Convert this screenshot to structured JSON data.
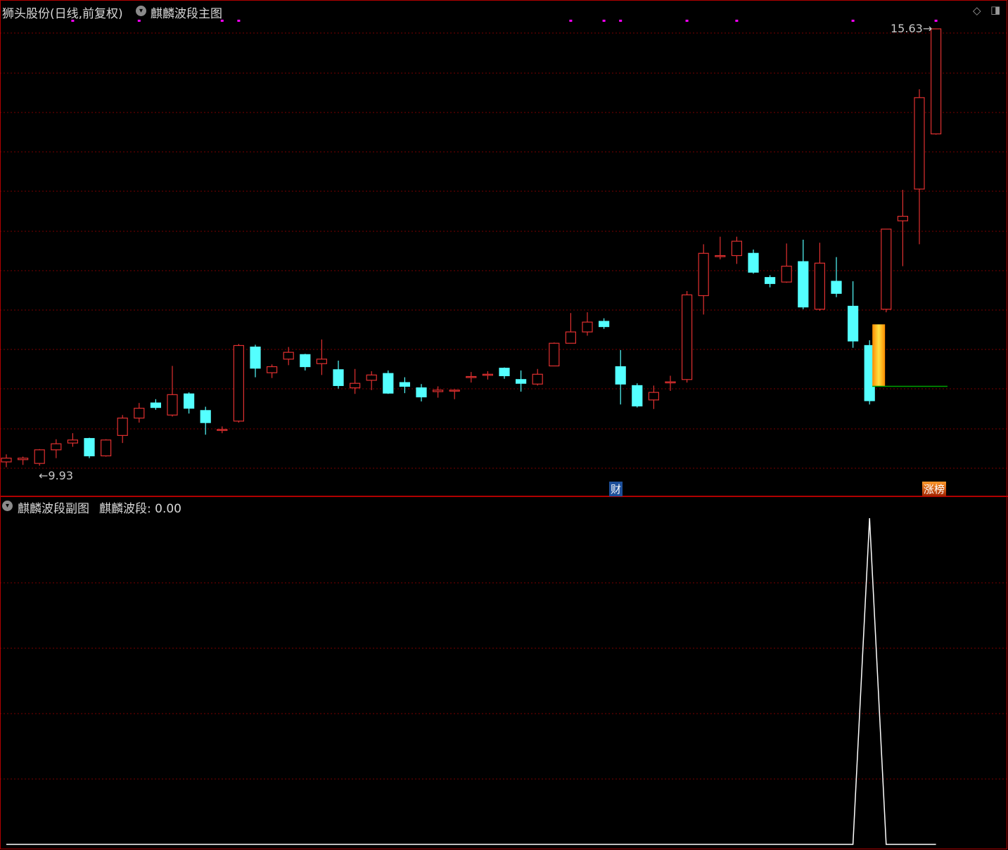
{
  "main_panel": {
    "stock_title": "狮头股份(日线,前复权)",
    "indicator_name": "麒麟波段主图",
    "high_label": "15.63",
    "low_label": "9.93",
    "tag_finance": "财",
    "tag_limit_up": "涨榜"
  },
  "sub_panel": {
    "indicator_name": "麒麟波段副图",
    "series_label": "麒麟波段:",
    "series_value": "0.00"
  },
  "icons": [
    "chevron-down-icon",
    "diamond-icon",
    "window-icon"
  ],
  "colors": {
    "up": "#e03030",
    "down": "#54ffff",
    "grid": "#7a0000",
    "separator": "#b00000",
    "marker": "#ff00ff",
    "support_line": "#00a000",
    "signal_bar": "#ffaa00",
    "sub_line": "#ffffff"
  },
  "chart_data": [
    {
      "type": "candlestick",
      "title": "麒麟波段主图",
      "ylim": [
        9.5,
        16.0
      ],
      "grid": true,
      "annotations": [
        {
          "text": "15.63",
          "kind": "period-high"
        },
        {
          "text": "9.93",
          "kind": "period-low"
        }
      ],
      "candles": [
        [
          10.0,
          10.05,
          9.93,
          10.1
        ],
        [
          10.03,
          10.05,
          9.96,
          10.07
        ],
        [
          9.98,
          10.16,
          9.95,
          10.17
        ],
        [
          10.16,
          10.24,
          10.05,
          10.3
        ],
        [
          10.25,
          10.29,
          10.2,
          10.38
        ],
        [
          10.31,
          10.08,
          10.05,
          10.32
        ],
        [
          10.08,
          10.29,
          10.07,
          10.3
        ],
        [
          10.35,
          10.58,
          10.25,
          10.62
        ],
        [
          10.58,
          10.71,
          10.52,
          10.78
        ],
        [
          10.78,
          10.72,
          10.69,
          10.83
        ],
        [
          10.62,
          10.89,
          10.6,
          11.27
        ],
        [
          10.9,
          10.71,
          10.64,
          10.92
        ],
        [
          10.68,
          10.52,
          10.36,
          10.73
        ],
        [
          10.42,
          10.43,
          10.38,
          10.47
        ],
        [
          10.54,
          11.54,
          10.52,
          11.56
        ],
        [
          11.52,
          11.24,
          11.12,
          11.55
        ],
        [
          11.18,
          11.26,
          11.11,
          11.29
        ],
        [
          11.36,
          11.45,
          11.28,
          11.52
        ],
        [
          11.42,
          11.26,
          11.21,
          11.43
        ],
        [
          11.3,
          11.36,
          11.15,
          11.62
        ],
        [
          11.22,
          11.01,
          10.97,
          11.34
        ],
        [
          10.98,
          11.04,
          10.9,
          11.23
        ],
        [
          11.08,
          11.15,
          10.95,
          11.2
        ],
        [
          11.17,
          10.91,
          10.9,
          11.21
        ],
        [
          11.05,
          11.0,
          10.91,
          11.12
        ],
        [
          10.98,
          10.86,
          10.8,
          11.03
        ],
        [
          10.93,
          10.95,
          10.85,
          11.0
        ],
        [
          10.94,
          10.95,
          10.83,
          10.96
        ],
        [
          11.12,
          11.13,
          11.05,
          11.19
        ],
        [
          11.15,
          11.16,
          11.09,
          11.2
        ],
        [
          11.24,
          11.14,
          11.1,
          11.25
        ],
        [
          11.09,
          11.04,
          10.93,
          11.21
        ],
        [
          11.03,
          11.16,
          11.01,
          11.23
        ],
        [
          11.27,
          11.57,
          11.27,
          11.58
        ],
        [
          11.57,
          11.72,
          11.6,
          11.97
        ],
        [
          11.72,
          11.85,
          11.67,
          11.98
        ],
        [
          11.86,
          11.79,
          11.76,
          11.9
        ],
        [
          11.26,
          11.03,
          10.76,
          11.48
        ],
        [
          11.01,
          10.74,
          10.72,
          11.04
        ],
        [
          10.82,
          10.92,
          10.7,
          11.01
        ],
        [
          11.05,
          11.06,
          10.94,
          11.14
        ],
        [
          11.09,
          12.21,
          11.05,
          12.26
        ],
        [
          12.2,
          12.76,
          11.95,
          12.88
        ],
        [
          12.72,
          12.73,
          12.68,
          12.98
        ],
        [
          12.73,
          12.92,
          12.62,
          12.98
        ],
        [
          12.76,
          12.51,
          12.49,
          12.81
        ],
        [
          12.44,
          12.36,
          12.31,
          12.47
        ],
        [
          12.38,
          12.59,
          12.37,
          12.89
        ],
        [
          12.65,
          12.05,
          12.02,
          12.94
        ],
        [
          12.02,
          12.63,
          12.0,
          12.9
        ],
        [
          12.39,
          12.23,
          12.18,
          12.71
        ],
        [
          12.06,
          11.6,
          11.51,
          12.39
        ],
        [
          11.54,
          10.81,
          10.76,
          11.61
        ],
        [
          12.02,
          13.08,
          11.98,
          13.06
        ],
        [
          13.19,
          13.25,
          12.59,
          13.6
        ],
        [
          13.61,
          14.82,
          12.88,
          14.93
        ],
        [
          14.34,
          15.73,
          14.33,
          15.73
        ]
      ]
    },
    {
      "type": "line",
      "title": "麒麟波段副图",
      "series": [
        {
          "name": "麒麟波段",
          "values": [
            0,
            0,
            0,
            0,
            0,
            0,
            0,
            0,
            0,
            0,
            0,
            0,
            0,
            0,
            0,
            0,
            0,
            0,
            0,
            0,
            0,
            0,
            0,
            0,
            0,
            0,
            0,
            0,
            0,
            0,
            0,
            0,
            0,
            0,
            0,
            0,
            0,
            0,
            0,
            0,
            0,
            0,
            0,
            0,
            0,
            0,
            0,
            0,
            0,
            0,
            0,
            0,
            1,
            0,
            0,
            0,
            0
          ],
          "last": 0.0
        }
      ]
    }
  ]
}
